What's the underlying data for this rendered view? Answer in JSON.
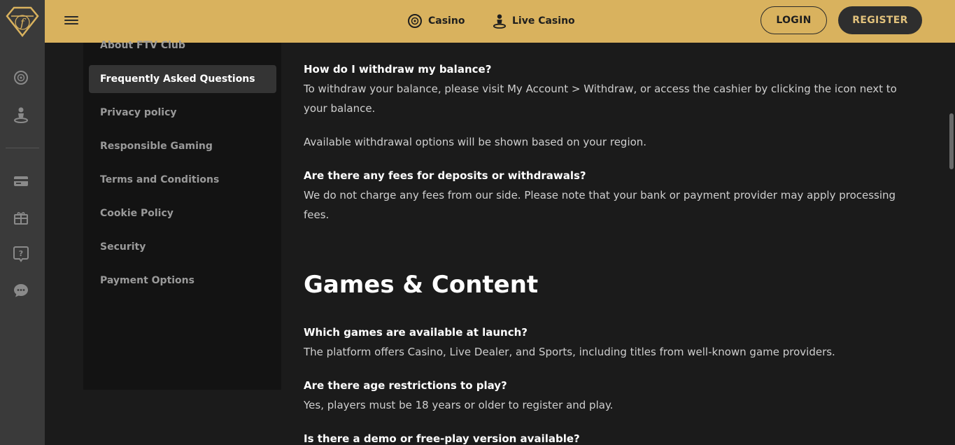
{
  "topbar": {
    "nav": [
      {
        "label": "Casino",
        "icon": "roulette-icon"
      },
      {
        "label": "Live Casino",
        "icon": "dealer-icon"
      }
    ],
    "login_label": "LOGIN",
    "register_label": "REGISTER"
  },
  "colors": {
    "topbar_bg": "#d9b25e",
    "rail_bg": "#3a3a3a",
    "page_bg": "#1b1b1b",
    "sidebar_bg": "#131313",
    "active_item_bg": "#343434",
    "register_text": "#e2c27c"
  },
  "rail": {
    "icons": [
      "ftv-logo-icon",
      "roulette-icon",
      "dealer-icon",
      "credit-card-icon",
      "gift-icon",
      "help-icon",
      "chat-icon"
    ]
  },
  "sidebar": {
    "items": [
      {
        "label": "About FTV Club",
        "active": false
      },
      {
        "label": "Frequently Asked Questions",
        "active": true
      },
      {
        "label": "Privacy policy",
        "active": false
      },
      {
        "label": "Responsible Gaming",
        "active": false
      },
      {
        "label": "Terms and Conditions",
        "active": false
      },
      {
        "label": "Cookie Policy",
        "active": false
      },
      {
        "label": "Security",
        "active": false
      },
      {
        "label": "Payment Options",
        "active": false
      }
    ]
  },
  "content": {
    "faq_withdraw": {
      "question": "How do I withdraw my balance?",
      "answer": "To withdraw your balance, please visit My Account > Withdraw, or access the cashier by clicking the icon next to your balance.",
      "answer2": "Available withdrawal options will be shown based on your region."
    },
    "faq_fees": {
      "question": "Are there any fees for deposits or withdrawals?",
      "answer": "We do not charge any fees from our side. Please note that your bank or payment provider may apply processing fees."
    },
    "section_heading": "Games & Content",
    "faq_games": {
      "question": "Which games are available at launch?",
      "answer": "The platform offers Casino, Live Dealer, and Sports, including titles from well-known game providers."
    },
    "faq_age": {
      "question": "Are there age restrictions to play?",
      "answer": "Yes, players must be 18 years or older to register and play."
    },
    "faq_demo": {
      "question": "Is there a demo or free-play version available?"
    }
  }
}
